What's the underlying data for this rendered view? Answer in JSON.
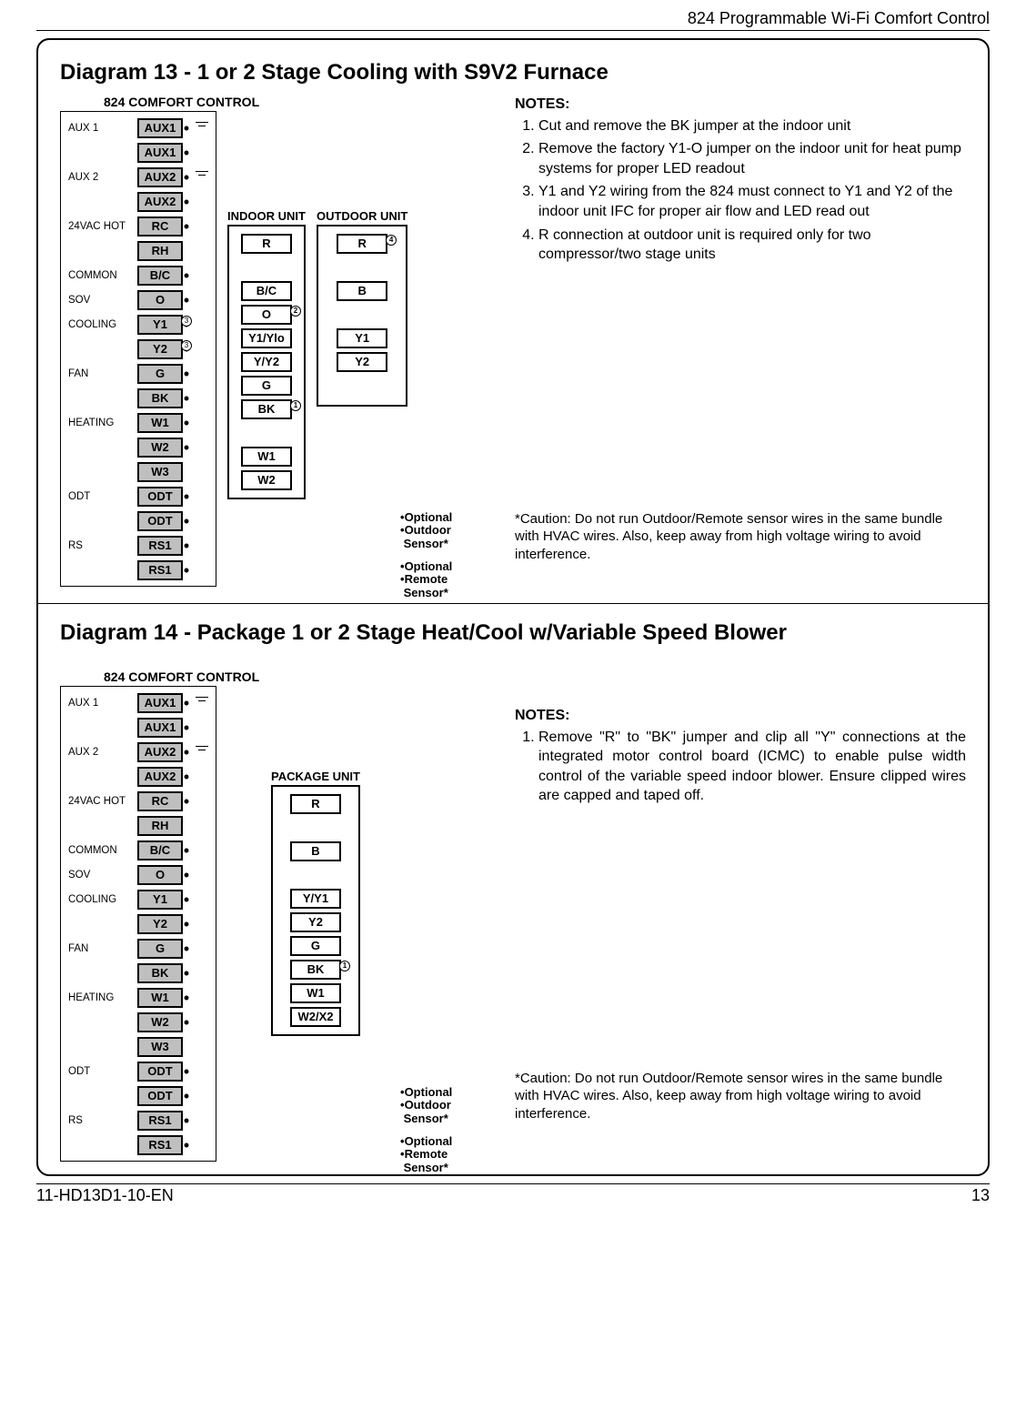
{
  "header": "824 Programmable Wi-Fi Comfort Control",
  "footer_left": "11-HD13D1-10-EN",
  "footer_right": "13",
  "d13": {
    "title": "Diagram 13 - 1 or 2 Stage Cooling with S9V2 Furnace",
    "ctrl_title": "824 COMFORT CONTROL",
    "indoor_title": "INDOOR UNIT",
    "outdoor_title": "OUTDOOR UNIT",
    "labels": {
      "aux1": "AUX 1",
      "aux2": "AUX 2",
      "hot": "24VAC HOT",
      "common": "COMMON",
      "sov": "SOV",
      "cooling": "COOLING",
      "fan": "FAN",
      "heating": "HEATING",
      "odt": "ODT",
      "rs": "RS"
    },
    "ctrl_terms": [
      "AUX1",
      "AUX1",
      "AUX2",
      "AUX2",
      "RC",
      "RH",
      "B/C",
      "O",
      "Y1",
      "Y2",
      "G",
      "BK",
      "W1",
      "W2",
      "W3",
      "ODT",
      "ODT",
      "RS1",
      "RS1"
    ],
    "indoor_terms": [
      "R",
      "B/C",
      "O",
      "Y1/Ylo",
      "Y/Y2",
      "G",
      "BK",
      "W1",
      "W2"
    ],
    "outdoor_terms": [
      "R",
      "B",
      "Y1",
      "Y2"
    ],
    "sup_y1": "3",
    "sup_y2": "3",
    "sup_o": "2",
    "sup_bk": "1",
    "sup_r": "4",
    "opt1_l1": "Optional",
    "opt1_l2": "Outdoor",
    "opt1_l3": "Sensor*",
    "opt2_l1": "Optional",
    "opt2_l2": "Remote",
    "opt2_l3": "Sensor*",
    "notes_h": "NOTES:",
    "notes": [
      "Cut and remove the BK jumper at the indoor unit",
      "Remove the factory Y1-O jumper on the indoor unit for heat pump systems for proper LED readout",
      "Y1 and Y2 wiring from the 824 must connect to Y1 and Y2 of the indoor unit IFC for proper air flow and LED read out",
      "R connection at outdoor unit is required only for two compressor/two stage units"
    ],
    "caution": "*Caution: Do not run Outdoor/Remote sensor wires in the same bundle with HVAC wires. Also, keep away from high voltage wiring to avoid interference."
  },
  "d14": {
    "title": "Diagram 14 - Package 1 or 2 Stage Heat/Cool w/Variable Speed Blower",
    "ctrl_title": "824 COMFORT CONTROL",
    "pkg_title": "PACKAGE UNIT",
    "labels": {
      "aux1": "AUX 1",
      "aux2": "AUX 2",
      "hot": "24VAC HOT",
      "common": "COMMON",
      "sov": "SOV",
      "cooling": "COOLING",
      "fan": "FAN",
      "heating": "HEATING",
      "odt": "ODT",
      "rs": "RS"
    },
    "ctrl_terms": [
      "AUX1",
      "AUX1",
      "AUX2",
      "AUX2",
      "RC",
      "RH",
      "B/C",
      "O",
      "Y1",
      "Y2",
      "G",
      "BK",
      "W1",
      "W2",
      "W3",
      "ODT",
      "ODT",
      "RS1",
      "RS1"
    ],
    "pkg_terms": [
      "R",
      "B",
      "Y/Y1",
      "Y2",
      "G",
      "BK",
      "W1",
      "W2/X2"
    ],
    "sup_bk": "1",
    "opt1_l1": "Optional",
    "opt1_l2": "Outdoor",
    "opt1_l3": "Sensor*",
    "opt2_l1": "Optional",
    "opt2_l2": "Remote",
    "opt2_l3": "Sensor*",
    "notes_h": "NOTES:",
    "notes": [
      "Remove \"R\" to \"BK\" jumper and clip all \"Y\" connections at the integrated motor control board (ICMC) to enable pulse width control of the variable speed indoor blower. Ensure clipped wires are capped and taped off."
    ],
    "caution": "*Caution: Do not run Outdoor/Remote sensor wires in the same bundle with HVAC wires. Also, keep away from high voltage wiring to avoid interference."
  }
}
